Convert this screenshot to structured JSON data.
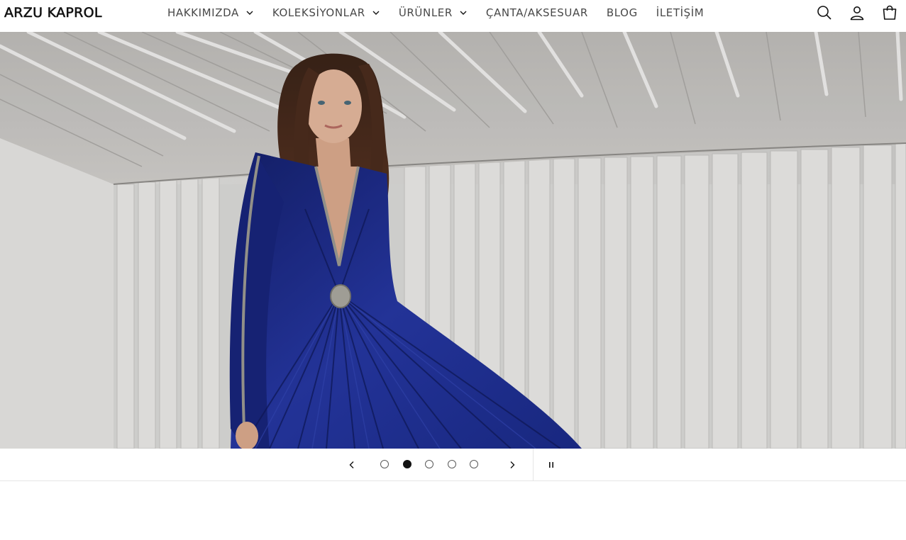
{
  "brand": {
    "logo_text": "ARZU KAPROL"
  },
  "nav": {
    "items": [
      {
        "label": "HAKKIMIZDA",
        "has_dropdown": true
      },
      {
        "label": "KOLEKSİYONLAR",
        "has_dropdown": true
      },
      {
        "label": "ÜRÜNLER",
        "has_dropdown": true
      },
      {
        "label": "ÇANTA/AKSESUAR",
        "has_dropdown": false
      },
      {
        "label": "BLOG",
        "has_dropdown": false
      },
      {
        "label": "İLETİŞİM",
        "has_dropdown": false
      }
    ]
  },
  "header_icons": [
    "search-icon",
    "account-icon",
    "cart-icon"
  ],
  "hero": {
    "image": "model-in-blue-pleated-gown",
    "dress_color": "#1f2f8c",
    "background_color": "#d8d6d3"
  },
  "slider": {
    "slide_count": 5,
    "active_slide": 2,
    "icons": [
      "chevron-left-icon",
      "chevron-right-icon",
      "pause-icon"
    ]
  },
  "colors": {
    "text": "#121212",
    "divider": "#e6e6e6"
  }
}
